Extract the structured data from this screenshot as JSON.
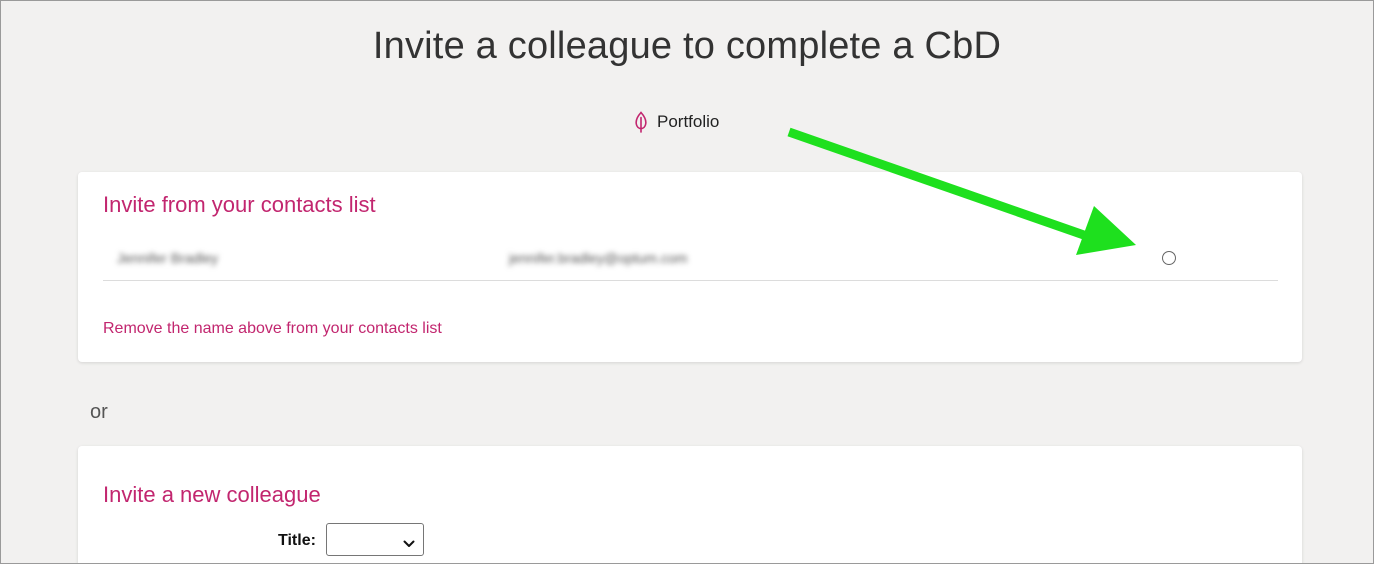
{
  "page": {
    "title": "Invite a colleague to complete a CbD",
    "portfolio_link": "Portfolio",
    "or_text": "or"
  },
  "contacts_card": {
    "heading": "Invite from your contacts list",
    "contacts": [
      {
        "name": "Jennifer Bradley",
        "email": "jennifer.bradley@optum.com",
        "selected": false
      }
    ],
    "remove_link": "Remove the name above from your contacts list"
  },
  "new_colleague_card": {
    "heading": "Invite a new colleague",
    "title_label": "Title:",
    "title_value": ""
  },
  "icons": {
    "portfolio": "leaf-icon",
    "select_chevron": "chevron-down-icon"
  },
  "colors": {
    "accent": "#c2266f",
    "annotation_arrow": "#1ee01e",
    "background": "#f2f1f0"
  }
}
